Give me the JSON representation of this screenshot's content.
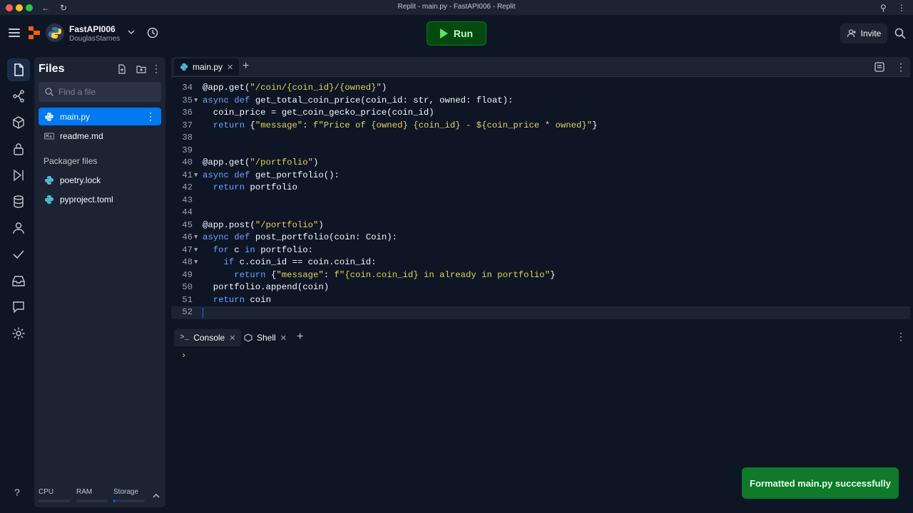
{
  "window": {
    "title": "Replit - main.py - FastAPI006 - Replit"
  },
  "project": {
    "name": "FastAPI006",
    "owner": "DouglasStarnes"
  },
  "header": {
    "run_label": "Run",
    "invite_label": "Invite"
  },
  "files": {
    "title": "Files",
    "search_placeholder": "Find a file",
    "items": [
      {
        "name": "main.py",
        "icon": "python-file-icon",
        "active": true
      },
      {
        "name": "readme.md",
        "icon": "markdown-file-icon",
        "active": false
      }
    ],
    "packager_title": "Packager files",
    "packager_items": [
      {
        "name": "poetry.lock",
        "icon": "python-file-icon"
      },
      {
        "name": "pyproject.toml",
        "icon": "python-file-icon"
      }
    ]
  },
  "resources": {
    "cpu_label": "CPU",
    "ram_label": "RAM",
    "storage_label": "Storage",
    "cpu": 0,
    "ram": 0,
    "storage": 0.05
  },
  "editor": {
    "tab_label": "main.py",
    "lines": [
      {
        "num": "34",
        "fold": "",
        "text": "@app.get(\"/coin/{coin_id}/{owned}\")"
      },
      {
        "num": "35",
        "fold": "▼",
        "text": "async def get_total_coin_price(coin_id: str, owned: float):"
      },
      {
        "num": "36",
        "fold": "",
        "text": "  coin_price = get_coin_gecko_price(coin_id)"
      },
      {
        "num": "37",
        "fold": "",
        "text": "  return {\"message\": f\"Price of {owned} {coin_id} - ${coin_price * owned}\"}"
      },
      {
        "num": "38",
        "fold": "",
        "text": ""
      },
      {
        "num": "39",
        "fold": "",
        "text": ""
      },
      {
        "num": "40",
        "fold": "",
        "text": "@app.get(\"/portfolio\")"
      },
      {
        "num": "41",
        "fold": "▼",
        "text": "async def get_portfolio():"
      },
      {
        "num": "42",
        "fold": "",
        "text": "  return portfolio"
      },
      {
        "num": "43",
        "fold": "",
        "text": ""
      },
      {
        "num": "44",
        "fold": "",
        "text": ""
      },
      {
        "num": "45",
        "fold": "",
        "text": "@app.post(\"/portfolio\")"
      },
      {
        "num": "46",
        "fold": "▼",
        "text": "async def post_portfolio(coin: Coin):"
      },
      {
        "num": "47",
        "fold": "▼",
        "text": "  for c in portfolio:"
      },
      {
        "num": "48",
        "fold": "▼",
        "text": "    if c.coin_id == coin.coin_id:"
      },
      {
        "num": "49",
        "fold": "",
        "text": "      return {\"message\": f\"{coin.coin_id} in already in portfolio\"}"
      },
      {
        "num": "50",
        "fold": "",
        "text": "  portfolio.append(coin)"
      },
      {
        "num": "51",
        "fold": "",
        "text": "  return coin"
      },
      {
        "num": "52",
        "fold": "",
        "text": ""
      }
    ]
  },
  "console": {
    "tabs": [
      {
        "label": "Console"
      },
      {
        "label": "Shell"
      }
    ],
    "prompt": "›"
  },
  "toast": {
    "message": "Formatted main.py successfully"
  },
  "colors": {
    "accent": "#0079f2",
    "run": "#044a10",
    "toast": "#0e7a2a",
    "keyword": "#6ba4ff",
    "string": "#e3d35d",
    "function": "#f5f9fc"
  }
}
